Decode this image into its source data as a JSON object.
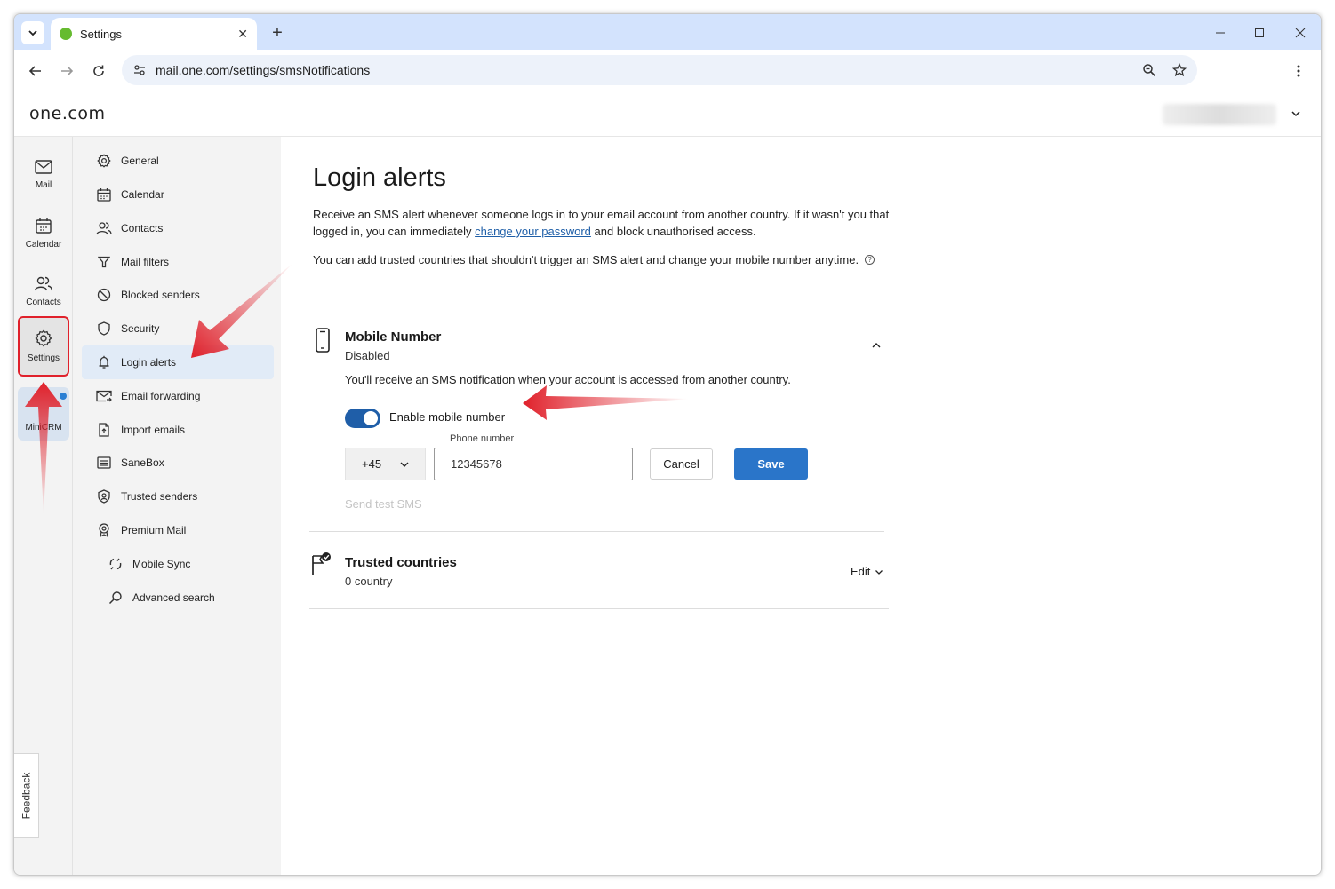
{
  "browser": {
    "tab_title": "Settings",
    "url": "mail.one.com/settings/smsNotifications"
  },
  "app": {
    "logo": "one.com"
  },
  "rail": {
    "items": [
      {
        "label": "Mail",
        "icon": "mail-icon"
      },
      {
        "label": "Calendar",
        "icon": "calendar-icon"
      },
      {
        "label": "Contacts",
        "icon": "contacts-icon"
      },
      {
        "label": "Settings",
        "icon": "gear-icon"
      },
      {
        "label": "MiniCRM",
        "icon": "minicrm-icon"
      }
    ],
    "feedback": "Feedback"
  },
  "settings_nav": {
    "items": [
      {
        "label": "General",
        "icon": "gear-icon"
      },
      {
        "label": "Calendar",
        "icon": "calendar-icon"
      },
      {
        "label": "Contacts",
        "icon": "contacts-icon"
      },
      {
        "label": "Mail filters",
        "icon": "filter-icon"
      },
      {
        "label": "Blocked senders",
        "icon": "block-icon"
      },
      {
        "label": "Security",
        "icon": "shield-icon"
      },
      {
        "label": "Login alerts",
        "icon": "bell-icon"
      },
      {
        "label": "Email forwarding",
        "icon": "forward-mail-icon"
      },
      {
        "label": "Import emails",
        "icon": "import-icon"
      },
      {
        "label": "SaneBox",
        "icon": "sanebox-icon"
      },
      {
        "label": "Trusted senders",
        "icon": "trusted-icon"
      },
      {
        "label": "Premium Mail",
        "icon": "badge-icon"
      },
      {
        "label": "Mobile Sync",
        "icon": "sync-icon"
      },
      {
        "label": "Advanced search",
        "icon": "search-icon"
      }
    ],
    "active": "Login alerts"
  },
  "main": {
    "title": "Login alerts",
    "intro_before": "Receive an SMS alert whenever someone logs in to your email account from another country. If it wasn't you that logged in, you can immediately ",
    "intro_link": "change your password",
    "intro_after": " and block unauthorised access.",
    "intro2": "You can add trusted countries that shouldn't trigger an SMS alert and change your mobile number anytime.",
    "mobile": {
      "title": "Mobile Number",
      "status": "Disabled",
      "description": "You'll receive an SMS notification when your account is accessed from another country.",
      "toggle_label": "Enable mobile number",
      "toggle_on": true,
      "country_code": "+45",
      "phone_label": "Phone number",
      "phone_value": "12345678",
      "cancel": "Cancel",
      "save": "Save",
      "send_test": "Send test SMS"
    },
    "trusted": {
      "title": "Trusted countries",
      "count": "0 country",
      "edit": "Edit"
    }
  },
  "colors": {
    "accent": "#2a75c9",
    "toggle": "#1f5ea8",
    "annotation": "#e0212b"
  }
}
